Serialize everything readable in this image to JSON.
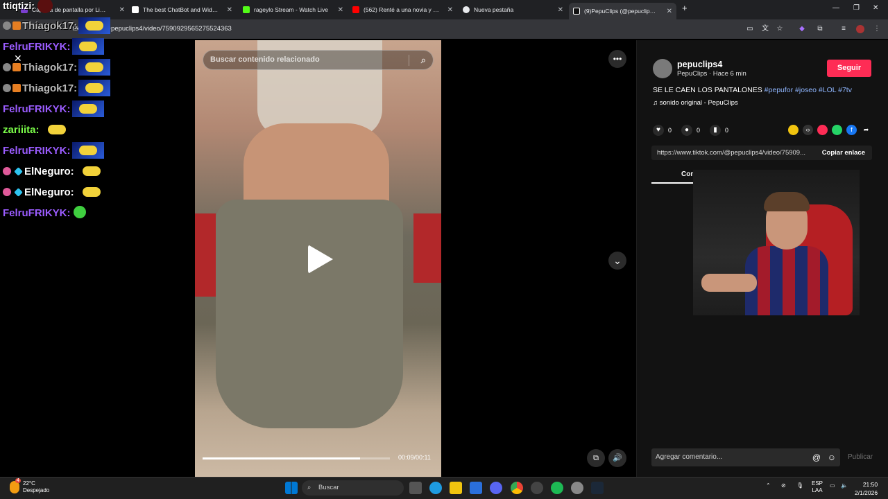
{
  "browser": {
    "tabs": [
      {
        "title": "Captura de pantalla por Lightshot",
        "color": "#7b3fd0"
      },
      {
        "title": "The best ChatBot and Widgets",
        "color": "#ffffff"
      },
      {
        "title": "rageylo Stream - Watch Live",
        "color": "#53fc18"
      },
      {
        "title": "(562) Renté a una novia y a un",
        "color": "#ff0000"
      },
      {
        "title": "Nueva pestaña",
        "color": "#e8eaed"
      },
      {
        "title": "(9)PepuClips (@pepuclips4)",
        "color": "#ffffff"
      }
    ],
    "url": "tiktok.com/@pepuclips4/video/7590929565275524363"
  },
  "chat": {
    "top_user": "ttiqtizi:",
    "messages": [
      {
        "user": "Thiagok17:",
        "color": "#b8b8b8"
      },
      {
        "user": "FelruFRIKYK:",
        "color": "#9b5cff"
      },
      {
        "user": "Thiagok17:",
        "color": "#b8b8b8"
      },
      {
        "user": "Thiagok17:",
        "color": "#b8b8b8"
      },
      {
        "user": "FelruFRIKYK:",
        "color": "#9b5cff"
      },
      {
        "user": "zariiita:",
        "color": "#7cff4a"
      },
      {
        "user": "FelruFRIKYK:",
        "color": "#9b5cff"
      },
      {
        "user": "ElNeguro:",
        "color": "#ffffff"
      },
      {
        "user": "ElNeguro:",
        "color": "#ffffff"
      },
      {
        "user": "FelruFRIKYK:",
        "color": "#9b5cff"
      }
    ]
  },
  "video": {
    "search_placeholder": "Buscar contenido relacionado",
    "time": "00:09/00:11",
    "progress": 0.84
  },
  "panel": {
    "username": "pepuclips4",
    "subline": "PepuClips · Hace 6 min",
    "follow": "Seguir",
    "desc_text": "SE LE CAEN LOS PANTALONES",
    "hashtags": "#pepufor #joseo #LOL #7tv",
    "music": "sonido original - PepuClips",
    "likes": "0",
    "comments": "0",
    "saves": "0",
    "link": "https://www.tiktok.com/@pepuclips4/video/75909...",
    "copy": "Copiar enlace",
    "comments_tab": "Com",
    "comment_placeholder": "Agregar comentario...",
    "publish": "Publicar"
  },
  "taskbar": {
    "temp": "22°C",
    "weather": "Despejado",
    "badge": "4",
    "search": "Buscar",
    "lang": "ESP",
    "lang2": "LAA",
    "time": "21:50",
    "date": "2/1/2026"
  },
  "accent": "#fe2c55"
}
